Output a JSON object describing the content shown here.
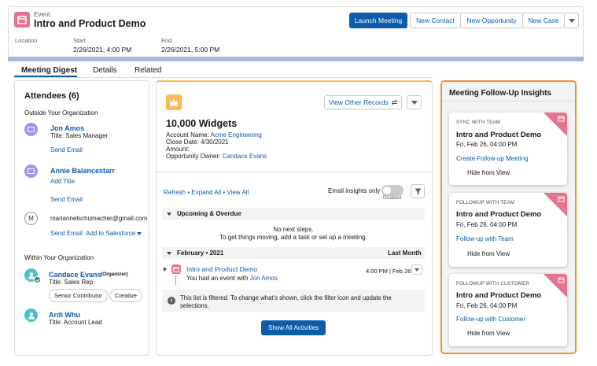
{
  "header": {
    "object_type": "Event",
    "title": "Intro and Product Demo",
    "actions": [
      "Launch Meeting",
      "New Contact",
      "New Opportunity",
      "New Case"
    ],
    "fields": [
      {
        "label": "Location",
        "value": ""
      },
      {
        "label": "Start",
        "value": "2/26/2021, 4:00 PM"
      },
      {
        "label": "End",
        "value": "2/26/2021, 5:00 PM"
      }
    ]
  },
  "tabs": [
    "Meeting Digest",
    "Details",
    "Related"
  ],
  "attendees": {
    "title": "Attendees (6)",
    "outside_label": "Outside Your Organization",
    "outside": [
      {
        "name": "Jon Amos",
        "subtitle": "Title: Sales Manager",
        "action": "Send Email"
      },
      {
        "name": "Annie Balancestarr",
        "subtitle": "Add Title",
        "action": "Send Email"
      },
      {
        "initial": "M",
        "name": "mariannelschumacher@gmail.com",
        "action": "Send Email",
        "action2": "Add to Salesforce"
      }
    ],
    "within_label": "Within Your Organization",
    "within": [
      {
        "name": "Candace Evans",
        "tag": "(Organizer)",
        "subtitle": "Title: Sales Rep",
        "badges": [
          "Senior Contributor",
          "Creative"
        ]
      },
      {
        "name": "Ardi Whu",
        "subtitle": "Title: Account Lead"
      }
    ]
  },
  "opportunity": {
    "view_button": "View Other Records",
    "title": "10,000 Widgets",
    "account_label": "Account Name:",
    "account": "Acme Engineering",
    "close_label": "Close Date:",
    "close": "4/30/2021",
    "amount_label": "Amount:",
    "amount": "",
    "owner_label": "Opportunity Owner:",
    "owner": "Candace Evans",
    "toolbar": {
      "refresh": "Refresh",
      "sep": "•",
      "expand": "Expand All",
      "view": "View All",
      "email_only": "Email insights only",
      "toggle_state": "Disabled"
    },
    "upcoming_header": "Upcoming & Overdue",
    "no_steps": "No next steps.",
    "no_steps_hint": "To get things moving, add a task or set up a meeting.",
    "month_header": "February • 2021",
    "month_tag": "Last Month",
    "activity": {
      "title": "Intro and Product Demo",
      "time": "4:00 PM | Feb 26",
      "desc_prefix": "You had an event with",
      "desc_link": "Jon Amos"
    },
    "filter_note": "This list is filtered. To change what's shown, click the filter icon and update the selections.",
    "show_all": "Show All Activities"
  },
  "insights": {
    "title": "Meeting Follow-Up Insights",
    "cards": [
      {
        "kind": "SYNC WITH TEAM",
        "title": "Intro and Product Demo",
        "date": "Fri, Feb 26, 04:00 PM",
        "action": "Create Follow-up Meeting",
        "hide": "Hide from View"
      },
      {
        "kind": "FOLLOWUP WITH TEAM",
        "title": "Intro and Product Demo",
        "date": "Fri, Feb 26, 04:00 PM",
        "action": "Follow-up with Team",
        "hide": "Hide from View"
      },
      {
        "kind": "FOLLOWUP WITH CUSTOMER",
        "title": "Intro and Product Demo",
        "date": "Fri, Feb 26, 04:00 PM",
        "action": "Follow-up with Customer",
        "hide": "Hide from View"
      }
    ]
  },
  "colors": {
    "brand": "#0b5cab",
    "event_icon": "#e3738f",
    "opp_icon": "#fcb95b",
    "highlight": "#f09033",
    "avatar_contact": "#a094ed",
    "avatar_user": "#48c3cc"
  }
}
